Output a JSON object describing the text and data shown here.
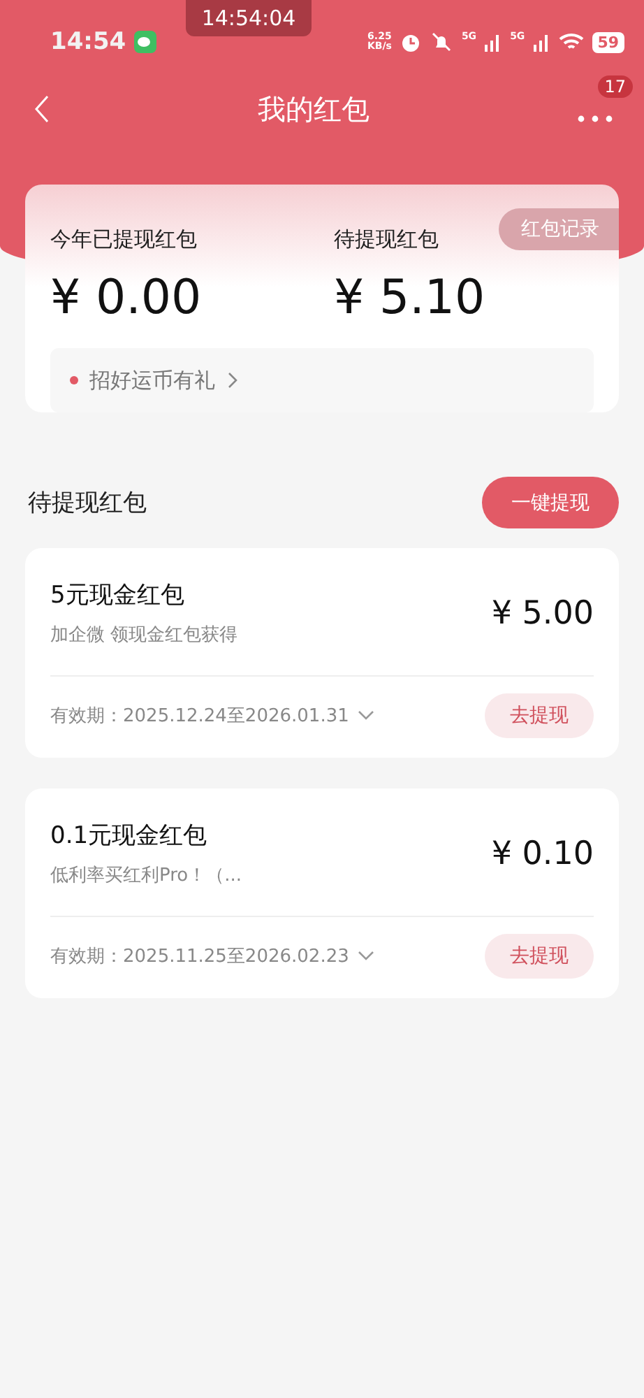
{
  "status_bar": {
    "time": "14:54",
    "recording_time": "14:54:04",
    "network_speed": "6.25",
    "network_unit": "KB/s",
    "signal_1": "5G",
    "signal_2": "5G",
    "battery": "59"
  },
  "nav": {
    "title": "我的红包",
    "badge": "17"
  },
  "summary": {
    "record_button": "红包记录",
    "stats": [
      {
        "label": "今年已提现红包",
        "amount": "¥ 0.00"
      },
      {
        "label": "待提现红包",
        "amount": "¥ 5.10"
      }
    ],
    "promo": "招好运币有礼"
  },
  "section": {
    "title": "待提现红包",
    "action": "一键提现"
  },
  "packets": [
    {
      "title": "5元现金红包",
      "subtitle": "加企微 领现金红包获得",
      "amount": "¥ 5.00",
      "validity": "有效期：2025.12.24至2026.01.31",
      "button": "去提现"
    },
    {
      "title": "0.1元现金红包",
      "subtitle": "低利率买红利Pro！（...",
      "amount": "¥ 0.10",
      "validity": "有效期：2025.11.25至2026.02.23",
      "button": "去提现"
    }
  ]
}
